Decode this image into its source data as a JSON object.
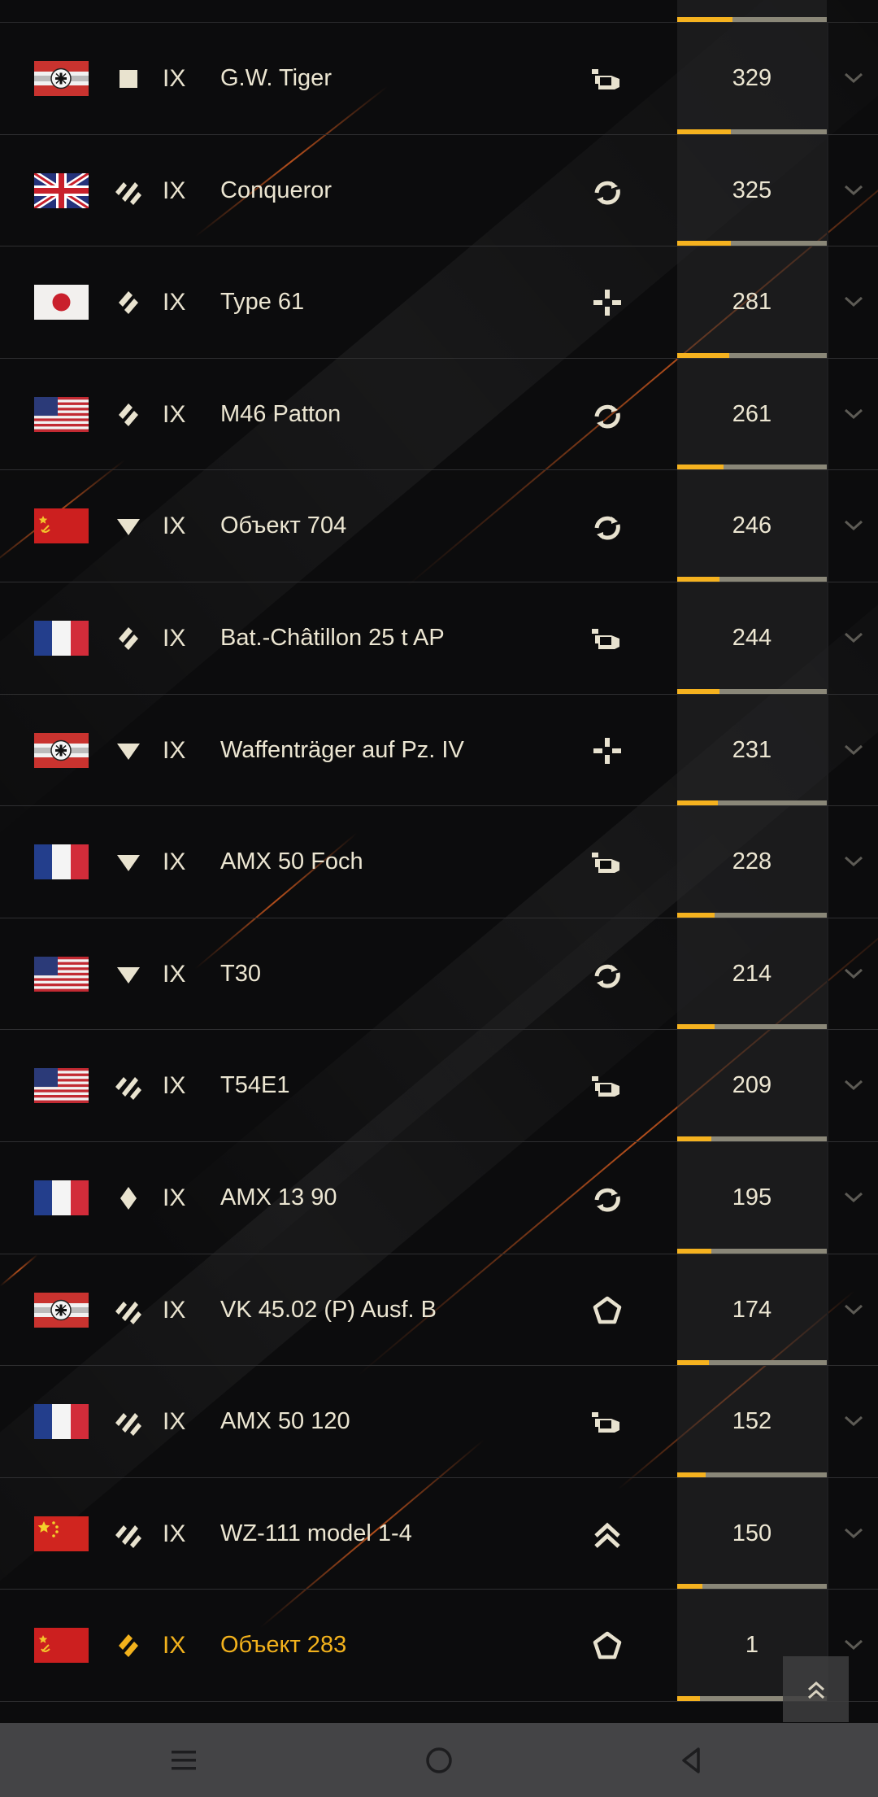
{
  "rows": [
    {
      "nation": "germany",
      "type_icon": "heavy-tank-icon",
      "tier": "IX",
      "name": "G.W. Tiger",
      "role_icon": "spg-role-icon",
      "count": "329",
      "progress": 0.36,
      "premium": false
    },
    {
      "nation": "uk",
      "type_icon": "medium-tank-icon",
      "tier": "IX",
      "name": "Conqueror",
      "role_icon": "versatile-role-icon",
      "count": "325",
      "progress": 0.36,
      "premium": false
    },
    {
      "nation": "japan",
      "type_icon": "light-tank-icon",
      "tier": "IX",
      "name": "Type 61",
      "role_icon": "support-role-icon",
      "count": "281",
      "progress": 0.35,
      "premium": false
    },
    {
      "nation": "usa",
      "type_icon": "light-tank-icon",
      "tier": "IX",
      "name": "M46 Patton",
      "role_icon": "versatile-role-icon",
      "count": "261",
      "progress": 0.31,
      "premium": false
    },
    {
      "nation": "ussr",
      "type_icon": "td-icon",
      "tier": "IX",
      "name": "Объект 704",
      "role_icon": "versatile-role-icon",
      "count": "246",
      "progress": 0.28,
      "premium": false
    },
    {
      "nation": "france",
      "type_icon": "light-tank-icon",
      "tier": "IX",
      "name": "Bat.-Châtillon 25 t AP",
      "role_icon": "spg-role-icon",
      "count": "244",
      "progress": 0.28,
      "premium": false
    },
    {
      "nation": "germany",
      "type_icon": "td-icon",
      "tier": "IX",
      "name": "Waffenträger auf Pz. IV",
      "role_icon": "support-role-icon",
      "count": "231",
      "progress": 0.27,
      "premium": false
    },
    {
      "nation": "france",
      "type_icon": "td-icon",
      "tier": "IX",
      "name": "AMX 50 Foch",
      "role_icon": "spg-role-icon",
      "count": "228",
      "progress": 0.25,
      "premium": false
    },
    {
      "nation": "usa",
      "type_icon": "td-icon",
      "tier": "IX",
      "name": "T30",
      "role_icon": "versatile-role-icon",
      "count": "214",
      "progress": 0.25,
      "premium": false
    },
    {
      "nation": "usa",
      "type_icon": "medium-tank-icon",
      "tier": "IX",
      "name": "T54E1",
      "role_icon": "spg-role-icon",
      "count": "209",
      "progress": 0.23,
      "premium": false
    },
    {
      "nation": "france",
      "type_icon": "light-diamond-icon",
      "tier": "IX",
      "name": "AMX 13 90",
      "role_icon": "versatile-role-icon",
      "count": "195",
      "progress": 0.23,
      "premium": false
    },
    {
      "nation": "germany",
      "type_icon": "medium-tank-icon",
      "tier": "IX",
      "name": "VK 45.02 (P) Ausf. B",
      "role_icon": "heavy-role-icon",
      "count": "174",
      "progress": 0.21,
      "premium": false
    },
    {
      "nation": "france",
      "type_icon": "medium-tank-icon",
      "tier": "IX",
      "name": "AMX 50 120",
      "role_icon": "spg-role-icon",
      "count": "152",
      "progress": 0.19,
      "premium": false
    },
    {
      "nation": "china",
      "type_icon": "medium-tank-icon",
      "tier": "IX",
      "name": "WZ-111 model 1-4",
      "role_icon": "assault-role-icon",
      "count": "150",
      "progress": 0.17,
      "premium": false
    },
    {
      "nation": "ussr",
      "type_icon": "light-tank-icon",
      "tier": "IX",
      "name": "Объект 283",
      "role_icon": "heavy-role-icon",
      "count": "1",
      "progress": 0.15,
      "premium": true
    }
  ],
  "top_strip_progress": 0.37,
  "colors": {
    "accent": "#f5b21f",
    "premium_text": "#f3b21c",
    "bar_track": "#8a8778"
  },
  "icons": {
    "scroll_top": "double-chevron-up-icon",
    "nav_menu": "menu-icon",
    "nav_home": "home-circle-icon",
    "nav_back": "back-triangle-icon"
  }
}
